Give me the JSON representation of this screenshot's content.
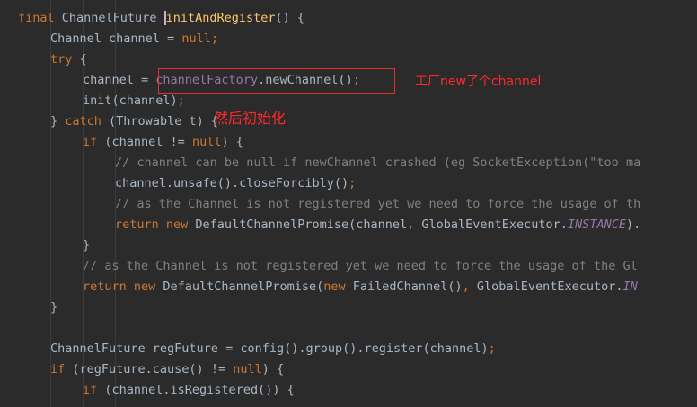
{
  "lines": [
    [
      {
        "t": "final ",
        "c": "kw"
      },
      {
        "t": "ChannelFuture ",
        "c": "id"
      },
      {
        "t": "initAndRegister",
        "c": "fn"
      },
      {
        "t": "() {",
        "c": "id"
      }
    ],
    [
      {
        "t": "Channel channel = ",
        "c": "id"
      },
      {
        "t": "null",
        "c": "kw"
      },
      {
        "t": ";",
        "c": "kw"
      }
    ],
    [
      {
        "t": "try ",
        "c": "kw"
      },
      {
        "t": "{",
        "c": "id"
      }
    ],
    [
      {
        "t": "channel = ",
        "c": "id"
      },
      {
        "t": "channelFactory",
        "c": "fld"
      },
      {
        "t": ".newChannel()",
        "c": "id"
      },
      {
        "t": ";",
        "c": "kw"
      }
    ],
    [
      {
        "t": "init(channel)",
        "c": "id"
      },
      {
        "t": ";",
        "c": "kw"
      }
    ],
    [
      {
        "t": "} ",
        "c": "id"
      },
      {
        "t": "catch ",
        "c": "kw"
      },
      {
        "t": "(Throwable t) {",
        "c": "id"
      }
    ],
    [
      {
        "t": "if ",
        "c": "kw"
      },
      {
        "t": "(channel != ",
        "c": "id"
      },
      {
        "t": "null",
        "c": "kw"
      },
      {
        "t": ") {",
        "c": "id"
      }
    ],
    [
      {
        "t": "// channel can be null if newChannel crashed (eg SocketException(\"too ma",
        "c": "cm"
      }
    ],
    [
      {
        "t": "channel.unsafe().closeForcibly()",
        "c": "id"
      },
      {
        "t": ";",
        "c": "kw"
      }
    ],
    [
      {
        "t": "// as the Channel is not registered yet we need to force the usage of th",
        "c": "cm"
      }
    ],
    [
      {
        "t": "return new ",
        "c": "kw"
      },
      {
        "t": "DefaultChannelPromise(channel",
        "c": "id"
      },
      {
        "t": ", ",
        "c": "kw"
      },
      {
        "t": "GlobalEventExecutor.",
        "c": "id"
      },
      {
        "t": "INSTANCE",
        "c": "ifld"
      },
      {
        "t": ").",
        "c": "id"
      }
    ],
    [
      {
        "t": "}",
        "c": "id"
      }
    ],
    [
      {
        "t": "// as the Channel is not registered yet we need to force the usage of the Gl",
        "c": "cm"
      }
    ],
    [
      {
        "t": "return new ",
        "c": "kw"
      },
      {
        "t": "DefaultChannelPromise(",
        "c": "id"
      },
      {
        "t": "new ",
        "c": "kw"
      },
      {
        "t": "FailedChannel()",
        "c": "id"
      },
      {
        "t": ", ",
        "c": "kw"
      },
      {
        "t": "GlobalEventExecutor.",
        "c": "id"
      },
      {
        "t": "IN",
        "c": "ifld"
      }
    ],
    [
      {
        "t": "}",
        "c": "id"
      }
    ],
    [],
    [
      {
        "t": "ChannelFuture regFuture = config().group().register(channel)",
        "c": "id"
      },
      {
        "t": ";",
        "c": "kw"
      }
    ],
    [
      {
        "t": "if ",
        "c": "kw"
      },
      {
        "t": "(regFuture.cause() != ",
        "c": "id"
      },
      {
        "t": "null",
        "c": "kw"
      },
      {
        "t": ") {",
        "c": "id"
      }
    ],
    [
      {
        "t": "if ",
        "c": "kw"
      },
      {
        "t": "(channel.isRegistered()) {",
        "c": "id"
      }
    ]
  ],
  "annotations": {
    "factory_note": "工厂new了个channel",
    "init_note": "然后初始化"
  },
  "colors": {
    "background": "#2b2b2b",
    "keyword": "#cc7832",
    "identifier": "#a9b7c6",
    "method_decl": "#ffc66d",
    "field": "#9876aa",
    "comment": "#808080",
    "annotation_red": "#ff2a2a"
  }
}
